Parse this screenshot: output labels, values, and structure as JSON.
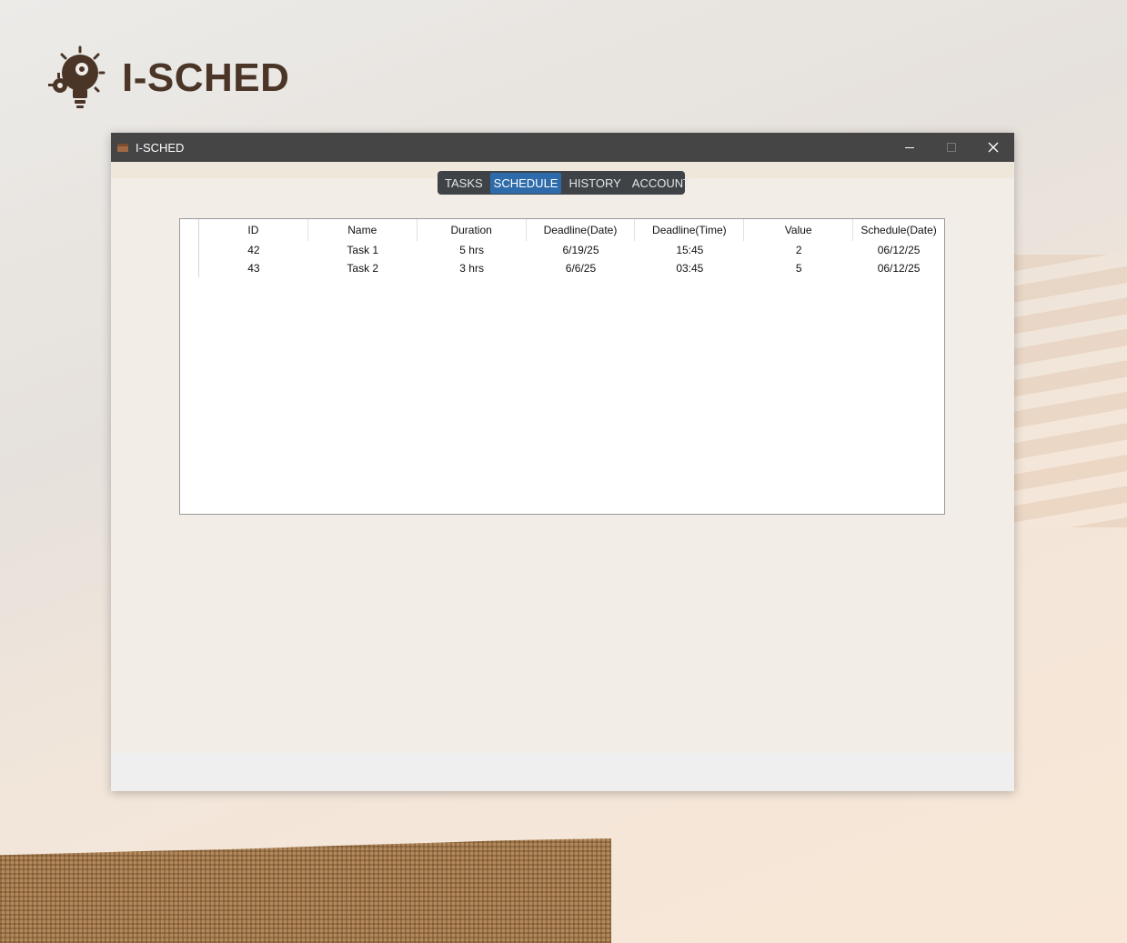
{
  "brand": {
    "title": "I-SCHED",
    "logo_icon": "lightbulb-gear-icon",
    "color": "#4a3527"
  },
  "window": {
    "title": "I-SCHED",
    "controls": [
      "minimize-icon",
      "maximize-icon",
      "close-icon"
    ]
  },
  "nav": {
    "tabs": [
      {
        "label": "TASKS",
        "active": false
      },
      {
        "label": "SCHEDULE",
        "active": true
      },
      {
        "label": "HISTORY",
        "active": false
      },
      {
        "label": "ACCOUNT",
        "active": false
      }
    ],
    "accent": "#2e6bab"
  },
  "table": {
    "columns": [
      "ID",
      "Name",
      "Duration",
      "Deadline(Date)",
      "Deadline(Time)",
      "Value",
      "Schedule(Date)"
    ],
    "rows": [
      [
        "42",
        "Task 1",
        "5 hrs",
        "6/19/25",
        "15:45",
        "2",
        "06/12/25"
      ],
      [
        "43",
        "Task 2",
        "3 hrs",
        "6/6/25",
        "03:45",
        "5",
        "06/12/25"
      ]
    ]
  }
}
